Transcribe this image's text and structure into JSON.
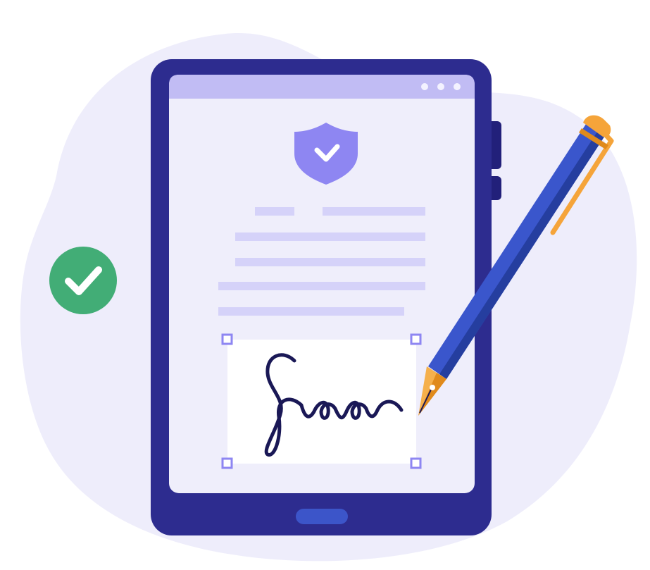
{
  "illustration": {
    "subject": "tablet-e-signature",
    "icons": [
      "verified-check-icon",
      "shield-check-icon",
      "pen-icon",
      "signature"
    ]
  },
  "colors": {
    "background": "#ffffff",
    "blob": "#eeedfb",
    "device_frame": "#2d2c8f",
    "device_button": "#22207a",
    "screen": "#efeefb",
    "screen_header": "#c1bcf4",
    "header_dots": "#f3f2ff",
    "shield": "#8e86f2",
    "shield_check": "#ffffff",
    "text_lines": "#d5d2f9",
    "signature_box": "#ffffff",
    "handle_fill": "#ffffff",
    "handle_stroke": "#8e86f2",
    "signature_ink": "#1a1856",
    "check_circle": "#42ad76",
    "check_mark": "#ffffff",
    "home_button": "#3c55c9",
    "pen_body": "#3a56cc",
    "pen_shadow": "#253e9f",
    "pen_clip": "#f5a43a",
    "pen_nib": "#f5b04c",
    "pen_nib_dark": "#e08a1c"
  }
}
